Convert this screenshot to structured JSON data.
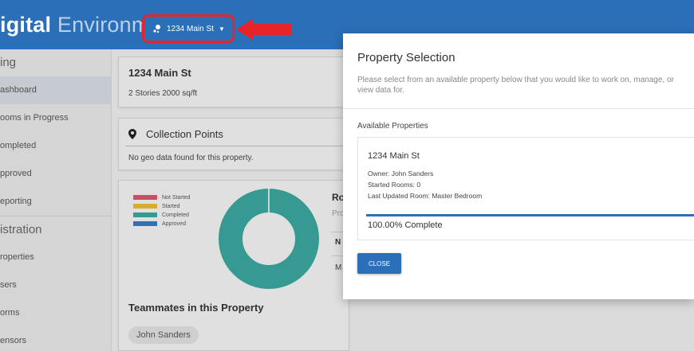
{
  "header": {
    "title_bold": "igital",
    "title_light": " Environment",
    "property_selector": "1234 Main St",
    "caret_glyph": "▼"
  },
  "sidebar": {
    "section1": "ing",
    "items1": [
      "ashboard",
      "ooms in Progress",
      "ompleted",
      "pproved",
      "eporting"
    ],
    "section2": "istration",
    "items2": [
      "roperties",
      "sers",
      "orms",
      "ensors"
    ]
  },
  "property_card": {
    "name": "1234 Main St",
    "details": "2 Stories 2000 sq/ft"
  },
  "collection": {
    "title": "Collection Points",
    "empty_text": "No geo data found for this property."
  },
  "status_chart": {
    "legend": [
      {
        "label": "Not Started",
        "color": "#d9566b"
      },
      {
        "label": "Started",
        "color": "#e3b834"
      },
      {
        "label": "Completed",
        "color": "#3aa39c"
      },
      {
        "label": "Approved",
        "color": "#3179c2"
      }
    ],
    "rooms_heading": "Ro",
    "progress_heading": "Pro",
    "col_header": "N",
    "row_value": "M"
  },
  "teammates": {
    "title": "Teammates in this Property",
    "members": [
      "John Sanders"
    ]
  },
  "modal": {
    "title": "Property Selection",
    "description": "Please select from an available property below that you would like to work on, manage, or view data for.",
    "available_label": "Available Properties",
    "property": {
      "name": "1234 Main St",
      "owner": "Owner: John Sanders",
      "started_rooms": "Started Rooms: 0",
      "last_updated": "Last Updated Room: Master Bedroom",
      "complete": "100.00% Complete"
    },
    "close_label": "CLOSE"
  },
  "colors": {
    "primary": "#2a6fb8",
    "highlight_red": "#e8242b",
    "donut_teal": "#3aa39c"
  }
}
